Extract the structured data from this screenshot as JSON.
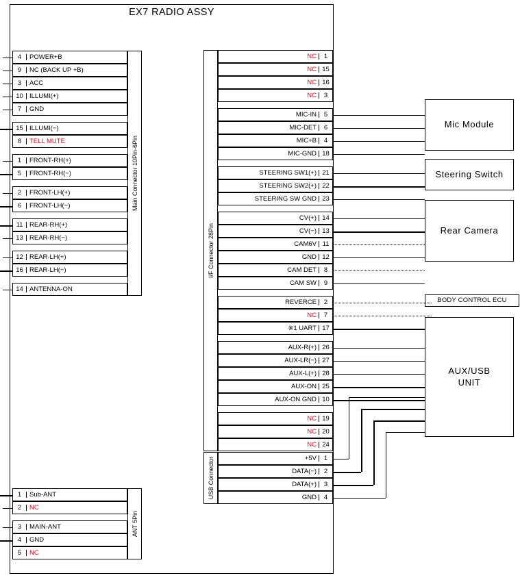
{
  "title": "EX7 RADIO ASSY",
  "colors": {
    "nc_red": "#e8001c",
    "line_black": "#000000",
    "background": "#ffffff"
  },
  "main_connector": {
    "name": "Main Connector  10Pin-6Pin",
    "rows": [
      {
        "pin": "4",
        "signal": "POWER+B",
        "nc": false,
        "alert": false,
        "wire": "solid"
      },
      {
        "pin": "9",
        "signal": "NC (BACK UP +B)",
        "nc": false,
        "alert": false,
        "wire": "solid"
      },
      {
        "pin": "3",
        "signal": "ACC",
        "nc": false,
        "alert": false,
        "wire": "solid"
      },
      {
        "pin": "10",
        "signal": "ILLUMI(+)",
        "nc": false,
        "alert": false,
        "wire": "solid"
      },
      {
        "pin": "7",
        "signal": "GND",
        "nc": false,
        "alert": false,
        "wire": "solid"
      },
      {
        "pin": "15",
        "signal": "ILLUMI(−)",
        "nc": false,
        "alert": false,
        "wire": "thick"
      },
      {
        "pin": "8",
        "signal": "TELL MUTE",
        "nc": false,
        "alert": true,
        "wire": "none"
      },
      {
        "pin": "1",
        "signal": "FRONT-RH(+)",
        "nc": false,
        "alert": false,
        "wire": "solid"
      },
      {
        "pin": "5",
        "signal": "FRONT-RH(−)",
        "nc": false,
        "alert": false,
        "wire": "thick"
      },
      {
        "pin": "2",
        "signal": "FRONT-LH(+)",
        "nc": false,
        "alert": false,
        "wire": "solid"
      },
      {
        "pin": "6",
        "signal": "FRONT-LH(−)",
        "nc": false,
        "alert": false,
        "wire": "thick"
      },
      {
        "pin": "11",
        "signal": "REAR-RH(+)",
        "nc": false,
        "alert": false,
        "wire": "thick"
      },
      {
        "pin": "13",
        "signal": "REAR-RH(−)",
        "nc": false,
        "alert": false,
        "wire": "solid"
      },
      {
        "pin": "12",
        "signal": "REAR-LH(+)",
        "nc": false,
        "alert": false,
        "wire": "solid"
      },
      {
        "pin": "16",
        "signal": "REAR-LH(−)",
        "nc": false,
        "alert": false,
        "wire": "thick"
      },
      {
        "pin": "14",
        "signal": "ANTENNA-ON",
        "nc": false,
        "alert": false,
        "wire": "solid"
      }
    ]
  },
  "ant_connector": {
    "name": "ANT 5Pin",
    "rows": [
      {
        "pin": "1",
        "signal": "Sub-ANT",
        "nc": false,
        "wire": "thick"
      },
      {
        "pin": "2",
        "signal": "NC",
        "nc": true,
        "wire": "solid"
      },
      {
        "pin": "3",
        "signal": "MAIN-ANT",
        "nc": false,
        "wire": "solid"
      },
      {
        "pin": "4",
        "signal": "GND",
        "nc": false,
        "wire": "thick"
      },
      {
        "pin": "5",
        "signal": "NC",
        "nc": true,
        "wire": "none"
      }
    ]
  },
  "if_connector": {
    "name": "I/F Connector  28Pin",
    "rows": [
      {
        "pin": "1",
        "signal": "NC",
        "nc": true,
        "wire": "none"
      },
      {
        "pin": "15",
        "signal": "NC",
        "nc": true,
        "wire": "none"
      },
      {
        "pin": "16",
        "signal": "NC",
        "nc": true,
        "wire": "none"
      },
      {
        "pin": "3",
        "signal": "NC",
        "nc": true,
        "wire": "none"
      },
      {
        "pin": "5",
        "signal": "MIC-IN",
        "nc": false,
        "wire": "solid",
        "target": "mic"
      },
      {
        "pin": "6",
        "signal": "MIC-DET",
        "nc": false,
        "wire": "solid",
        "target": "mic"
      },
      {
        "pin": "4",
        "signal": "MIC+B",
        "nc": false,
        "wire": "solid",
        "target": "mic"
      },
      {
        "pin": "18",
        "signal": "MIC-GND",
        "nc": false,
        "wire": "solid",
        "target": "mic"
      },
      {
        "pin": "21",
        "signal": "STEERING SW1(+)",
        "nc": false,
        "wire": "solid",
        "target": "steering"
      },
      {
        "pin": "22",
        "signal": "STEERING SW2(+)",
        "nc": false,
        "wire": "thick",
        "target": "steering"
      },
      {
        "pin": "23",
        "signal": "STEERING SW GND",
        "nc": false,
        "wire": "solid",
        "target": "steering"
      },
      {
        "pin": "14",
        "signal": "CV(+)",
        "nc": false,
        "wire": "solid",
        "target": "camera"
      },
      {
        "pin": "13",
        "signal": "CV(−)",
        "nc": false,
        "wire": "thick",
        "target": "camera"
      },
      {
        "pin": "11",
        "signal": "CAM6V",
        "nc": false,
        "wire": "dotted",
        "target": "camera"
      },
      {
        "pin": "12",
        "signal": "GND",
        "nc": false,
        "wire": "solid",
        "target": "camera"
      },
      {
        "pin": "8",
        "signal": "CAM DET",
        "nc": false,
        "wire": "dotted",
        "target": "camera"
      },
      {
        "pin": "9",
        "signal": "CAM SW",
        "nc": false,
        "wire": "solid",
        "target": "camera"
      },
      {
        "pin": "2",
        "signal": "REVERCE",
        "nc": false,
        "wire": "dotted",
        "target": "none"
      },
      {
        "pin": "7",
        "signal": "NC",
        "nc": true,
        "wire": "dotted",
        "target": "none"
      },
      {
        "pin": "17",
        "signal": "※1  UART",
        "nc": false,
        "wire": "thick",
        "target": "ecu"
      },
      {
        "pin": "26",
        "signal": "AUX-R(+)",
        "nc": false,
        "wire": "solid",
        "target": "auxusb"
      },
      {
        "pin": "27",
        "signal": "AUX-LR(−)",
        "nc": false,
        "wire": "solid",
        "target": "auxusb"
      },
      {
        "pin": "28",
        "signal": "AUX-L(+)",
        "nc": false,
        "wire": "solid",
        "target": "auxusb"
      },
      {
        "pin": "25",
        "signal": "AUX-ON",
        "nc": false,
        "wire": "thick",
        "target": "auxusb"
      },
      {
        "pin": "10",
        "signal": "AUX-ON GND",
        "nc": false,
        "wire": "thick",
        "target": "auxusb"
      },
      {
        "pin": "19",
        "signal": "NC",
        "nc": true,
        "wire": "none"
      },
      {
        "pin": "20",
        "signal": "NC",
        "nc": true,
        "wire": "none"
      },
      {
        "pin": "24",
        "signal": "NC",
        "nc": true,
        "wire": "none"
      }
    ]
  },
  "usb_connector": {
    "name": "USB Connector",
    "rows": [
      {
        "pin": "1",
        "signal": "+5V",
        "nc": false,
        "wire": "solid",
        "target": "auxusb"
      },
      {
        "pin": "2",
        "signal": "DATA(−)",
        "nc": false,
        "wire": "thick",
        "target": "auxusb"
      },
      {
        "pin": "3",
        "signal": "DATA(+)",
        "nc": false,
        "wire": "thick",
        "target": "auxusb"
      },
      {
        "pin": "4",
        "signal": "GND",
        "nc": false,
        "wire": "solid",
        "target": "auxusb"
      }
    ]
  },
  "modules": [
    {
      "id": "mic",
      "label": "Mic Module"
    },
    {
      "id": "steering",
      "label": "Steering Switch"
    },
    {
      "id": "camera",
      "label": "Rear Camera"
    },
    {
      "id": "ecu",
      "label": "BODY CONTROL ECU"
    },
    {
      "id": "auxusb",
      "label": "AUX/USB\nUNIT"
    }
  ]
}
